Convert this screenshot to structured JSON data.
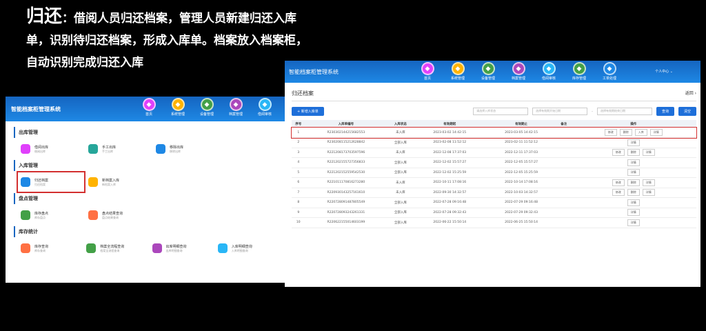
{
  "headline": {
    "prefix": "归还",
    "rest": "：借阅人员归还档案，管理人员新建归还入库单，识别待归还档案，形成入库单。档案放入档案柜，自动识别完成归还入库"
  },
  "app": {
    "title": "智能档案柜管理系统",
    "user": "个人中心 ⌄"
  },
  "navL": [
    {
      "label": "首页",
      "color": "#e040fb"
    },
    {
      "label": "系统管理",
      "color": "#ffb300"
    },
    {
      "label": "设备管理",
      "color": "#43a047"
    },
    {
      "label": "档案管理",
      "color": "#ab47bc"
    },
    {
      "label": "借阅审核",
      "color": "#29b6f6"
    }
  ],
  "navR": [
    {
      "label": "首页",
      "color": "#e040fb"
    },
    {
      "label": "系统管理",
      "color": "#ffb300"
    },
    {
      "label": "设备管理",
      "color": "#43a047"
    },
    {
      "label": "档案管理",
      "color": "#ab47bc"
    },
    {
      "label": "借阅审核",
      "color": "#29b6f6"
    },
    {
      "label": "库存管理",
      "color": "#43a047"
    },
    {
      "label": "工单处理",
      "color": "#1e88e5"
    }
  ],
  "left": {
    "sections": [
      {
        "title": "出库管理",
        "items": [
          {
            "t": "借阅出库",
            "s": "借阅出库",
            "c": "#e040fb"
          },
          {
            "t": "手工出库",
            "s": "手工出库",
            "c": "#26a69a"
          },
          {
            "t": "移除出库",
            "s": "移除出库",
            "c": "#1e88e5"
          }
        ]
      },
      {
        "title": "入库管理",
        "items": [
          {
            "t": "归还档案",
            "s": "归还档案",
            "c": "#1e88e5"
          },
          {
            "t": "新档案入库",
            "s": "新档案入库",
            "c": "#ffb300"
          }
        ]
      },
      {
        "title": "盘点管理",
        "items": [
          {
            "t": "库存盘点",
            "s": "库存盘点",
            "c": "#43a047"
          },
          {
            "t": "盘点结果查询",
            "s": "盘点结果查询",
            "c": "#ff7043"
          }
        ]
      },
      {
        "title": "库存统计",
        "items": [
          {
            "t": "库存查询",
            "s": "库存查询",
            "c": "#ff7043"
          },
          {
            "t": "档案全流程查询",
            "s": "档案全流程查询",
            "c": "#43a047"
          },
          {
            "t": "出库明细查询",
            "s": "出库明细查询",
            "c": "#ab47bc"
          },
          {
            "t": "入库明细查询",
            "s": "入库明细查询",
            "c": "#29b6f6"
          }
        ]
      }
    ]
  },
  "right": {
    "page_title": "归还档案",
    "back": "返回 ›",
    "new_btn": "+ 新增入库单",
    "search_placeholder": "请选择入库状态",
    "date_start": "选择有效期开始日期",
    "date_end": "选择有效期结束日期",
    "search_btn": "查询",
    "reset_btn": "清空",
    "columns": [
      "序号",
      "入库单编号",
      "入库状态",
      "有效期起",
      "有效期止",
      "备注",
      "操作"
    ],
    "rows": [
      {
        "no": "1",
        "code": "R230302144215682553",
        "status": "未入库",
        "start": "2023-03-02 14:42:15",
        "end": "2023-03-05 14:42:15",
        "ops": [
          "修改",
          "删除",
          "入库",
          "详情"
        ]
      },
      {
        "no": "2",
        "code": "R230208115212628842",
        "status": "全部入库",
        "start": "2023-02-08 11:52:12",
        "end": "2023-02-11 11:52:12",
        "ops": [
          "详情"
        ]
      },
      {
        "no": "3",
        "code": "R221208173703597596",
        "status": "未入库",
        "start": "2022-12-08 17:37:03",
        "end": "2022-12-11 17:37:03",
        "ops": [
          "修改",
          "删除",
          "详情"
        ]
      },
      {
        "no": "4",
        "code": "R221202155727356833",
        "status": "全部入库",
        "start": "2022-12-02 15:57:27",
        "end": "2022-12-05 15:57:27",
        "ops": [
          "详情"
        ]
      },
      {
        "no": "5",
        "code": "R221202152559542530",
        "status": "全部入库",
        "start": "2022-12-02 15:25:59",
        "end": "2022-12-05 15:25:59",
        "ops": [
          "详情"
        ]
      },
      {
        "no": "6",
        "code": "R221011170816273280",
        "status": "未入库",
        "start": "2022-10-11 17:08:16",
        "end": "2022-10-14 17:08:16",
        "ops": [
          "修改",
          "删除",
          "详情"
        ]
      },
      {
        "no": "7",
        "code": "R220930143257161610",
        "status": "未入库",
        "start": "2022-09-30 14:32:57",
        "end": "2022-10-03 14:32:57",
        "ops": [
          "修改",
          "删除",
          "详情"
        ]
      },
      {
        "no": "8",
        "code": "R220728091487805549",
        "status": "全部入库",
        "start": "2022-07-28 09:16:48",
        "end": "2022-07-29 09:16:48",
        "ops": [
          "详情"
        ]
      },
      {
        "no": "9",
        "code": "R220728093243261331",
        "status": "全部入库",
        "start": "2022-07-28 09:32:43",
        "end": "2022-07-29 09:32:43",
        "ops": [
          "详情"
        ]
      },
      {
        "no": "10",
        "code": "R220622155014603199",
        "status": "全部入库",
        "start": "2022-06-22 15:50:14",
        "end": "2022-06-25 15:50:14",
        "ops": [
          "详情"
        ]
      }
    ]
  }
}
